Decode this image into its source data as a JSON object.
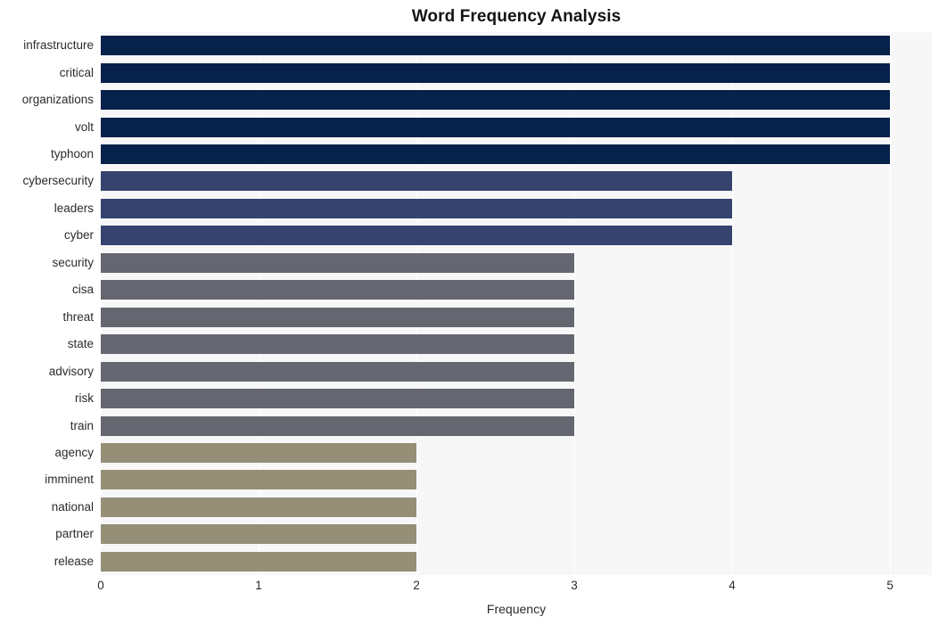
{
  "chart_data": {
    "type": "bar",
    "orientation": "horizontal",
    "title": "Word Frequency Analysis",
    "xlabel": "Frequency",
    "ylabel": "",
    "xlim": [
      0,
      5.265
    ],
    "xticks": [
      0,
      1,
      2,
      3,
      4,
      5
    ],
    "xtick_labels": [
      "0",
      "1",
      "2",
      "3",
      "4",
      "5"
    ],
    "grid": "vertical-white-gridlines",
    "legend": "none",
    "plot_background": "#f7f7f8",
    "categories": [
      "infrastructure",
      "critical",
      "organizations",
      "volt",
      "typhoon",
      "cybersecurity",
      "leaders",
      "cyber",
      "security",
      "cisa",
      "threat",
      "state",
      "advisory",
      "risk",
      "train",
      "agency",
      "imminent",
      "national",
      "partner",
      "release"
    ],
    "values": [
      5,
      5,
      5,
      5,
      5,
      4,
      4,
      4,
      3,
      3,
      3,
      3,
      3,
      3,
      3,
      2,
      2,
      2,
      2,
      2
    ],
    "bar_colors": [
      "#06224a",
      "#06224a",
      "#06224a",
      "#06224a",
      "#06224a",
      "#36436e",
      "#36436e",
      "#36436e",
      "#64676f",
      "#64676f",
      "#64676f",
      "#64676f",
      "#64676f",
      "#64676f",
      "#64676f",
      "#958f78",
      "#958f78",
      "#958f78",
      "#958f78",
      "#958f78"
    ],
    "palette": {
      "freq_5": "#06224a",
      "freq_4": "#36436e",
      "freq_3": "#64676f",
      "freq_2": "#958f78"
    }
  }
}
